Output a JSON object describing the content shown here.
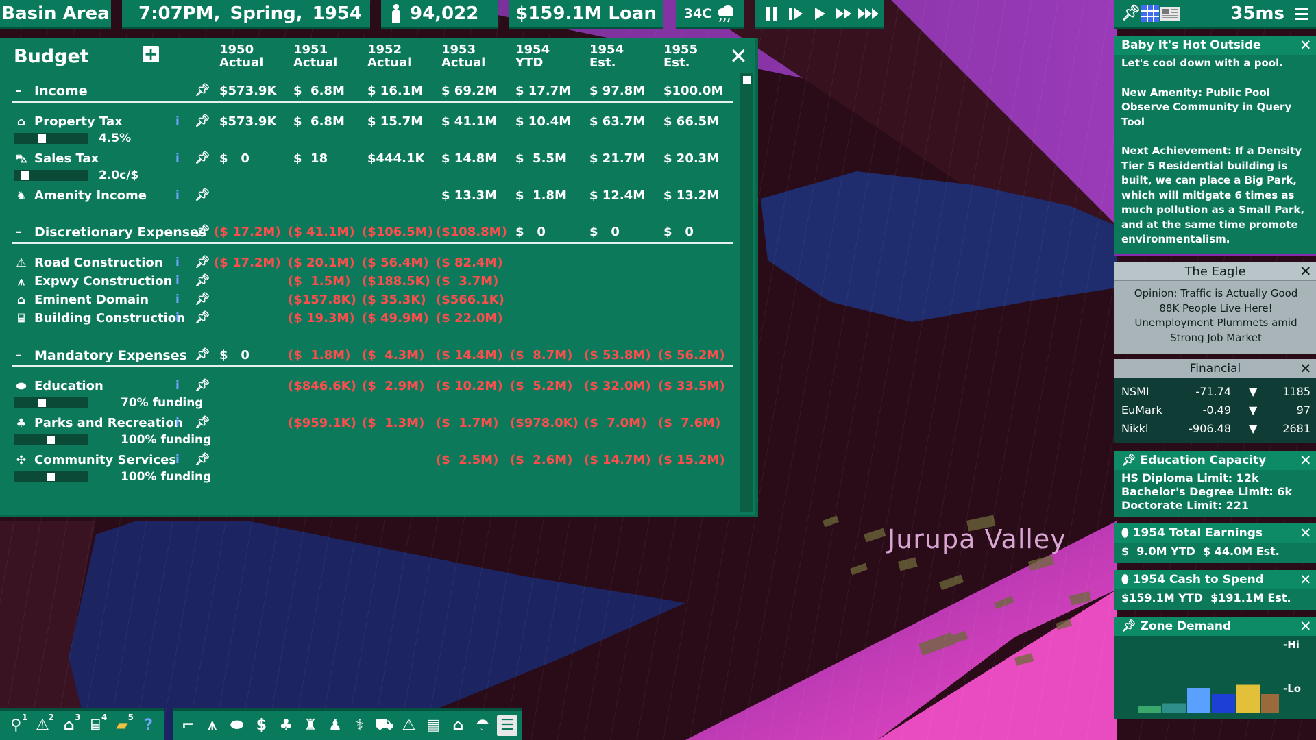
{
  "topbar": {
    "area": "Basin Area",
    "time": "7:07PM,",
    "season": "Spring,",
    "year": "1954",
    "population": "94,022",
    "loan": "$159.1M Loan",
    "temperature": "34C",
    "weather_icon": "rain-cloud-icon",
    "latency": "35ms",
    "speed_buttons": [
      "pause-icon",
      "step-icon",
      "play-icon",
      "fast-forward-icon",
      "fastest-icon"
    ],
    "right_icons": [
      "pin-icon",
      "grid-icon",
      "newspaper-icon",
      "menu-icon"
    ]
  },
  "budget": {
    "title": "Budget",
    "add_label": "+",
    "close_label": "✕",
    "columns": [
      {
        "year": "1950",
        "kind": "Actual"
      },
      {
        "year": "1951",
        "kind": "Actual"
      },
      {
        "year": "1952",
        "kind": "Actual"
      },
      {
        "year": "1953",
        "kind": "Actual"
      },
      {
        "year": "1954",
        "kind": "YTD"
      },
      {
        "year": "1954",
        "kind": "Est."
      },
      {
        "year": "1955",
        "kind": "Est."
      }
    ],
    "income": {
      "label": "Income",
      "values": [
        "$573.9K",
        "$  6.8M",
        "$ 16.1M",
        "$ 69.2M",
        "$ 17.7M",
        "$ 97.8M",
        "$100.0M"
      ],
      "rows": [
        {
          "label": "Property Tax",
          "icon": "house-icon",
          "values": [
            "$573.9K",
            "$  6.8M",
            "$ 15.7M",
            "$ 41.1M",
            "$ 10.4M",
            "$ 63.7M",
            "$ 66.5M"
          ],
          "slider_label": "4.5%",
          "slider_level": 0.35
        },
        {
          "label": "Sales Tax",
          "icon": "store-icon",
          "values": [
            "$   0",
            "$  18",
            "$444.1K",
            "$ 14.8M",
            "$  5.5M",
            "$ 21.7M",
            "$ 20.3M"
          ],
          "slider_label": "2.0c/$",
          "slider_level": 0.08
        },
        {
          "label": "Amenity Income",
          "icon": "amenity-icon",
          "values": [
            "",
            "",
            "",
            "$ 13.3M",
            "$  1.8M",
            "$ 12.4M",
            "$ 13.2M"
          ]
        }
      ]
    },
    "discretionary": {
      "label": "Discretionary Expenses",
      "values": [
        "($ 17.2M)",
        "($ 41.1M)",
        "($106.5M)",
        "($108.8M)",
        "$   0",
        "$   0",
        "$   0"
      ],
      "rows": [
        {
          "label": "Road Construction",
          "icon": "road-icon",
          "values": [
            "($ 17.2M)",
            "($ 20.1M)",
            "($ 56.4M)",
            "($ 82.4M)",
            "",
            "",
            ""
          ]
        },
        {
          "label": "Expwy Construction",
          "icon": "expressway-icon",
          "values": [
            "",
            "($  1.5M)",
            "($188.5K)",
            "($  3.7M)",
            "",
            "",
            ""
          ]
        },
        {
          "label": "Eminent Domain",
          "icon": "house-icon",
          "values": [
            "",
            "($157.8K)",
            "($ 35.3K)",
            "($566.1K)",
            "",
            "",
            ""
          ]
        },
        {
          "label": "Building Construction",
          "icon": "building-icon",
          "values": [
            "",
            "($ 19.3M)",
            "($ 49.9M)",
            "($ 22.0M)",
            "",
            "",
            ""
          ]
        }
      ]
    },
    "mandatory": {
      "label": "Mandatory Expenses",
      "values": [
        "$   0",
        "($  1.8M)",
        "($  4.3M)",
        "($ 14.4M)",
        "($  8.7M)",
        "($ 53.8M)",
        "($ 56.2M)"
      ],
      "rows": [
        {
          "label": "Education",
          "icon": "graduation-cap-icon",
          "values": [
            "",
            "($846.6K)",
            "($  2.9M)",
            "($ 10.2M)",
            "($  5.2M)",
            "($ 32.0M)",
            "($ 33.5M)"
          ],
          "slider_label": "70% funding",
          "slider_level": 0.35
        },
        {
          "label": "Parks and Recreation",
          "icon": "tree-icon",
          "values": [
            "",
            "($959.1K)",
            "($  1.3M)",
            "($  1.7M)",
            "($978.0K)",
            "($  7.0M)",
            "($  7.6M)"
          ],
          "slider_label": "100% funding",
          "slider_level": 0.5
        },
        {
          "label": "Community Services",
          "icon": "community-icon",
          "values": [
            "",
            "",
            "",
            "($  2.5M)",
            "($  2.6M)",
            "($ 14.7M)",
            "($ 15.2M)"
          ],
          "slider_label": "100% funding",
          "slider_level": 0.5
        }
      ]
    }
  },
  "panels": {
    "notice": {
      "title": "Baby It's Hot Outside",
      "lines": [
        "Let's cool down with a pool.",
        "",
        "New Amenity: Public Pool",
        "Observe Community in Query Tool",
        "",
        "Next Achievement: If a Density Tier 5 Residential building is built, we can place a Big Park, which will mitigate 6 times as much pollution as a Small Park, and at the same time promote environmentalism."
      ]
    },
    "eagle": {
      "title": "The Eagle",
      "headlines": [
        "Opinion: Traffic is Actually Good",
        "88K People Live Here!",
        "Unemployment Plummets amid Strong Job Market"
      ]
    },
    "financial": {
      "title": "Financial",
      "rows": [
        {
          "name": "NSMI",
          "change": "-71.74",
          "value": "1185"
        },
        {
          "name": "EuMark",
          "change": "-0.49",
          "value": "97"
        },
        {
          "name": "Nikkl",
          "change": "-906.48",
          "value": "2681"
        }
      ]
    },
    "education": {
      "title": "Education Capacity",
      "lines": [
        "HS Diploma Limit: 12k",
        "Bachelor's Degree Limit: 6k",
        "Doctorate Limit: 221"
      ]
    },
    "earnings": {
      "title": "1954 Total Earnings",
      "text": "$  9.0M YTD  $ 44.0M Est."
    },
    "cash": {
      "title": "1954 Cash to Spend",
      "text": "$159.1M YTD  $191.1M Est."
    },
    "zone": {
      "title": "Zone Demand",
      "hi": "-Hi",
      "lo": "-Lo",
      "bars": [
        {
          "zone": "residential-low",
          "color": "#3aa86b",
          "level": 0.1
        },
        {
          "zone": "residential-high",
          "color": "#2f8f8a",
          "level": 0.15
        },
        {
          "zone": "commercial-low",
          "color": "#5aa0ff",
          "level": 0.4
        },
        {
          "zone": "commercial-high",
          "color": "#1e3fd6",
          "level": 0.3
        },
        {
          "zone": "industrial-low",
          "color": "#e3c03a",
          "level": 0.45
        },
        {
          "zone": "industrial-high",
          "color": "#9a6a3a",
          "level": 0.3
        }
      ]
    }
  },
  "map": {
    "city_label": "Jurupa Valley"
  },
  "toolbar": {
    "left": [
      {
        "icon": "query-icon",
        "hotkey": "1"
      },
      {
        "icon": "road-icon",
        "hotkey": "2"
      },
      {
        "icon": "zone-icon",
        "hotkey": "3"
      },
      {
        "icon": "building-icon",
        "hotkey": "4"
      },
      {
        "icon": "bulldoze-icon",
        "hotkey": "5"
      },
      {
        "icon": "help-icon",
        "hotkey": ""
      }
    ],
    "right": [
      "road-curve-icon",
      "expressway-icon",
      "education-icon",
      "finance-icon",
      "parks-icon",
      "monument-icon",
      "community-icon",
      "health-icon",
      "transit-icon",
      "road-icon",
      "rail-icon",
      "housing-icon",
      "amenity-icon",
      "newspaper-icon"
    ]
  },
  "colors": {
    "panel_green": "#0c7a5a",
    "negative_red": "#ff4d4d",
    "info_blue": "#6fa4ff",
    "water": "#1e2a6a",
    "land": "#34101e",
    "land_edge": "#d43aa8"
  }
}
